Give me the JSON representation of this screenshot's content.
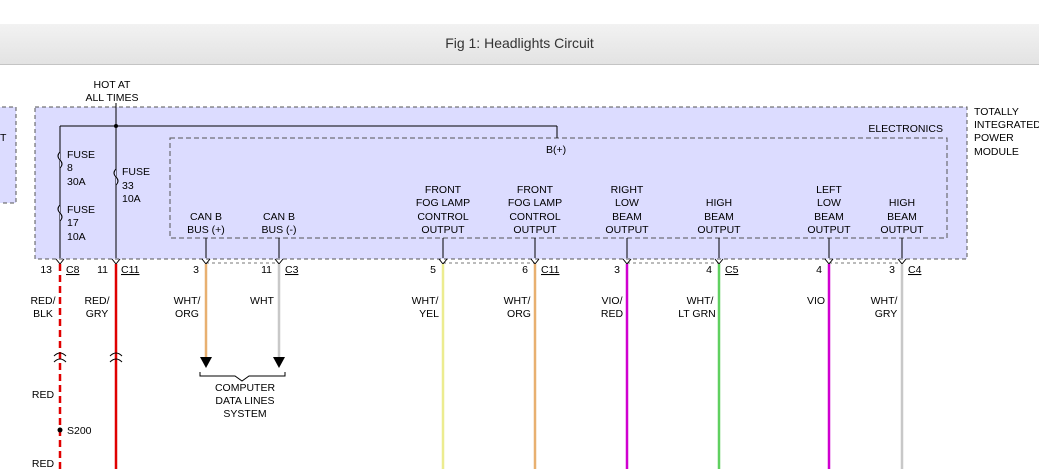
{
  "header": {
    "title": "Fig 1: Headlights Circuit"
  },
  "colors": {
    "module_fill": "#dcdcff",
    "red": "#e00000",
    "orange": "#e8b070",
    "white": "#c8c8c8",
    "yellow": "#ecec90",
    "violet": "#d000d0",
    "light_green": "#60d060"
  },
  "diagram": {
    "left_box_label": "T",
    "hot_at_all_times": [
      "HOT AT",
      "ALL TIMES"
    ],
    "module_name": [
      "TOTALLY",
      "INTEGRATED",
      "POWER",
      "MODULE"
    ],
    "electronics_label": "ELECTRONICS",
    "bplus_label": "B(+)",
    "fuses": [
      {
        "name": "FUSE",
        "number": "8",
        "rating": "30A"
      },
      {
        "name": "FUSE",
        "number": "17",
        "rating": "10A"
      },
      {
        "name": "FUSE",
        "number": "33",
        "rating": "10A"
      }
    ],
    "outputs": [
      {
        "lines": [
          "CAN B",
          "BUS (+)"
        ]
      },
      {
        "lines": [
          "CAN B",
          "BUS (-)"
        ]
      },
      {
        "lines": [
          "FRONT",
          "FOG LAMP",
          "CONTROL",
          "OUTPUT"
        ]
      },
      {
        "lines": [
          "FRONT",
          "FOG LAMP",
          "CONTROL",
          "OUTPUT"
        ]
      },
      {
        "lines": [
          "RIGHT",
          "LOW",
          "BEAM",
          "OUTPUT"
        ]
      },
      {
        "lines": [
          "HIGH",
          "BEAM",
          "OUTPUT"
        ]
      },
      {
        "lines": [
          "LEFT",
          "LOW",
          "BEAM",
          "OUTPUT"
        ]
      },
      {
        "lines": [
          "HIGH",
          "BEAM",
          "OUTPUT"
        ]
      }
    ],
    "pins": [
      {
        "pin": "13",
        "connector": "C8"
      },
      {
        "pin": "11",
        "connector": "C11"
      },
      {
        "pin": "3",
        "connector": ""
      },
      {
        "pin": "11",
        "connector": "C3"
      },
      {
        "pin": "5",
        "connector": ""
      },
      {
        "pin": "6",
        "connector": "C11"
      },
      {
        "pin": "3",
        "connector": ""
      },
      {
        "pin": "4",
        "connector": "C5"
      },
      {
        "pin": "4",
        "connector": ""
      },
      {
        "pin": "3",
        "connector": "C4"
      }
    ],
    "wires": [
      {
        "lines": [
          "RED/",
          "BLK"
        ]
      },
      {
        "lines": [
          "RED/",
          "GRY"
        ]
      },
      {
        "lines": [
          "WHT/",
          "ORG"
        ]
      },
      {
        "lines": [
          "WHT"
        ]
      },
      {
        "lines": [
          "WHT/",
          "YEL"
        ]
      },
      {
        "lines": [
          "WHT/",
          "ORG"
        ]
      },
      {
        "lines": [
          "VIO/",
          "RED"
        ]
      },
      {
        "lines": [
          "WHT/",
          "LT GRN"
        ]
      },
      {
        "lines": [
          "VIO"
        ]
      },
      {
        "lines": [
          "WHT/",
          "GRY"
        ]
      }
    ],
    "computer_system": [
      "COMPUTER",
      "DATA LINES",
      "SYSTEM"
    ],
    "red_labels": [
      "RED",
      "RED"
    ],
    "splice": "S200"
  }
}
